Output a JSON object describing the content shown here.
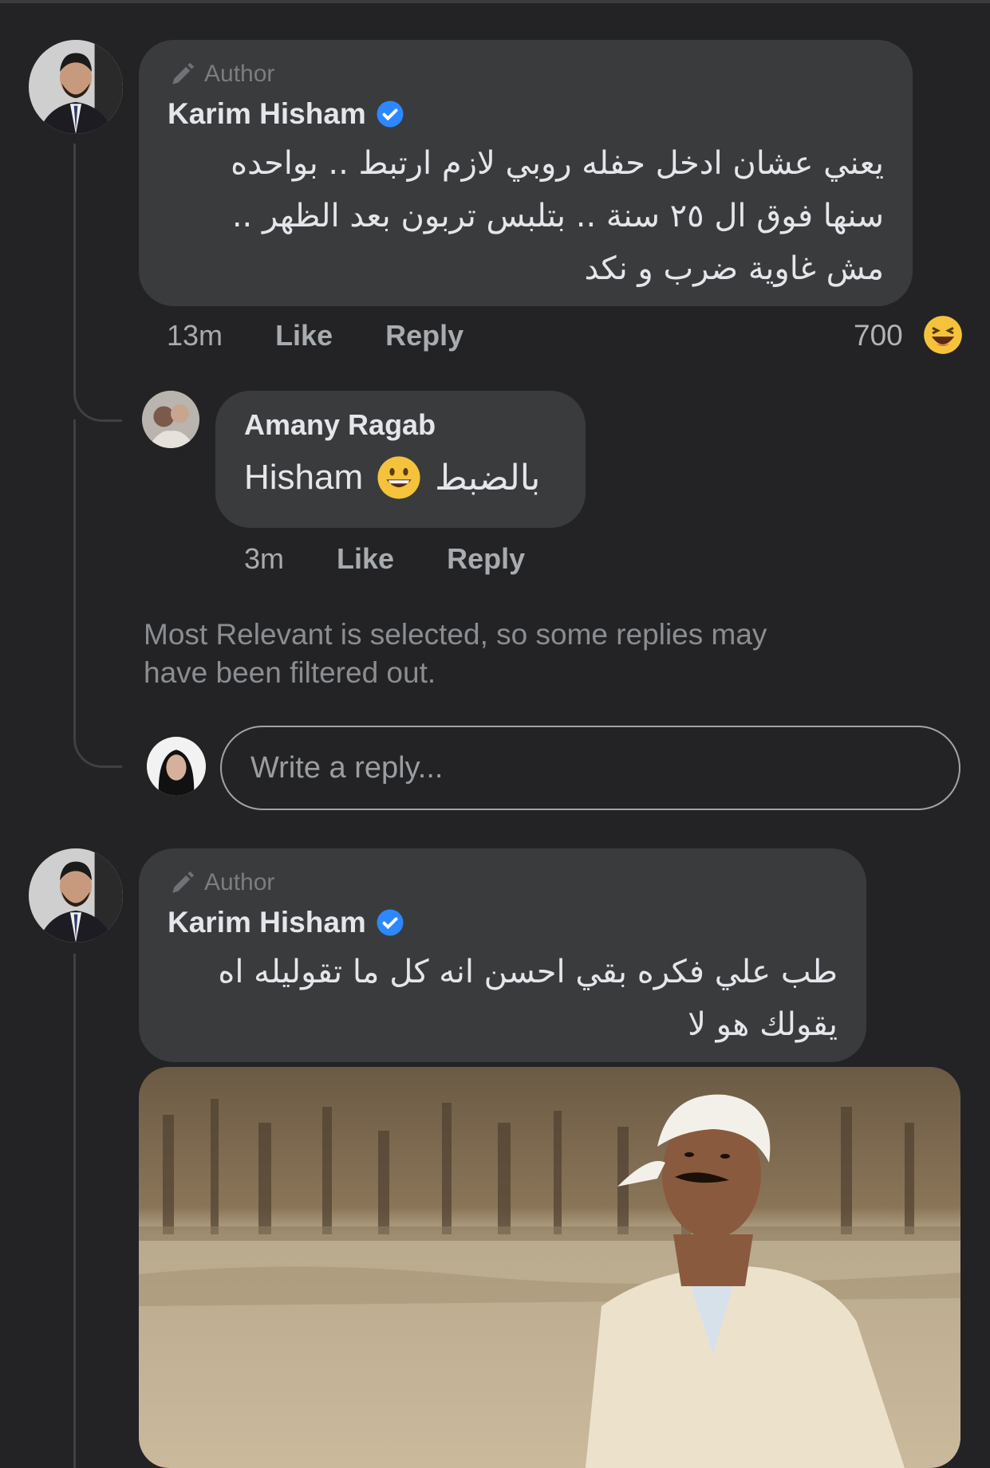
{
  "comments": [
    {
      "author_tag": "Author",
      "name": "Karim Hisham",
      "text_lines": [
        "يعني عشان ادخل حفله روبي لازم ارتبط .. بواحده",
        "سنها فوق ال ٢٥ سنة .. بتلبس تربون بعد الظهر ..",
        "مش غاوية ضرب و نكد"
      ],
      "time": "13m",
      "like_label": "Like",
      "reply_label": "Reply",
      "reaction_count": "700",
      "reaction_icon": "laughing-emoji-icon"
    },
    {
      "author_tag": "Author",
      "name": "Karim Hisham",
      "text_lines": [
        "طب علي فكره بقي احسن انه كل ما تقوليله اه",
        "يقولك هو لا"
      ],
      "image_alt": "meme-image"
    }
  ],
  "reply": {
    "name": "Amany Ragab",
    "text_ltr": "Hisham",
    "text_rtl": "بالضبط",
    "emoji": "grinning-emoji-icon",
    "time": "3m",
    "like_label": "Like",
    "reply_label": "Reply"
  },
  "notice": {
    "line1": "Most Relevant is selected, so some replies may",
    "line2": "have been filtered out."
  },
  "reply_input": {
    "placeholder": "Write a reply..."
  },
  "colors": {
    "background": "#232325",
    "bubble": "#3a3b3c",
    "verified": "#2d88ff",
    "emoji": "#f5c33b"
  }
}
